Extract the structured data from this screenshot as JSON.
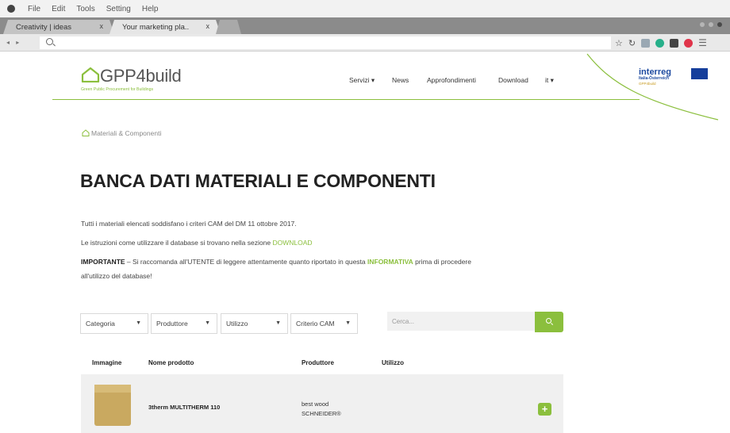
{
  "os_menu": [
    "File",
    "Edit",
    "Tools",
    "Setting",
    "Help"
  ],
  "tabs": [
    {
      "label": "Creativity | ideas",
      "close": "x",
      "active": false
    },
    {
      "label": "Your marketing pla..",
      "close": "x",
      "active": true
    }
  ],
  "addressbar": {
    "url": ""
  },
  "site": {
    "logo_text": "GPP4build",
    "logo_subtitle": "Green Public Procurement for Buildings",
    "nav": [
      "Servizi ▾",
      "News",
      "Approfondimenti",
      "Download",
      "it ▾"
    ],
    "partner_logo": {
      "line1": "interreg",
      "line2": "Italia-Österreich",
      "line3": "GPP4build"
    }
  },
  "breadcrumb": "Materiali & Componenti",
  "title": "BANCA DATI MATERIALI E COMPONENTI",
  "intro": {
    "line1": "Tutti i materiali elencati soddisfano i criteri CAM del DM 11 ottobre 2017.",
    "line2_pre": "Le istruzioni come utilizzare il database si trovano nella sezione ",
    "line2_link": "DOWNLOAD",
    "line3_bold": "IMPORTANTE",
    "line3_mid": " – Si raccomanda all'UTENTE di leggere attentamente quanto riportato in questa ",
    "line3_link": "INFORMATIVA",
    "line3_post": " prima di procedere",
    "line4": "all'utilizzo del database!"
  },
  "filters": [
    "Categoria",
    "Produttore",
    "Utilizzo",
    "Criterio CAM"
  ],
  "search": {
    "placeholder": "Cerca..."
  },
  "table": {
    "headers": [
      "Immagine",
      "Nome prodotto",
      "Produttore",
      "Utilizzo"
    ],
    "rows": [
      {
        "name": "3therm MULTITHERM 110",
        "producer_line1": "best wood",
        "producer_line2": "SCHNEIDER®",
        "usage": ""
      }
    ]
  },
  "colors": {
    "accent": "#8bbf3d",
    "interreg_blue": "#1d4aa0"
  }
}
